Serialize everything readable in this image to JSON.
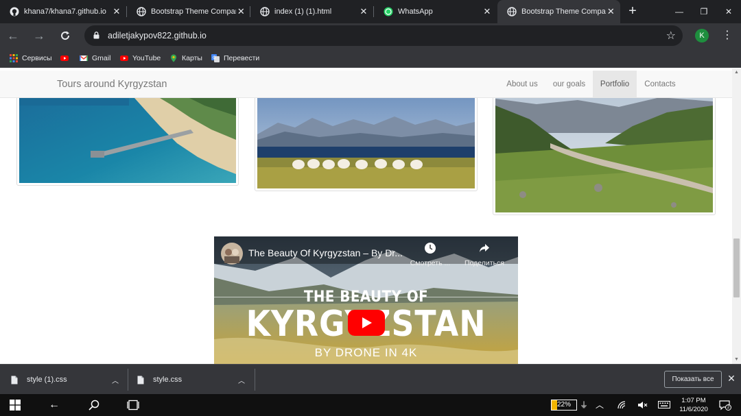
{
  "browser": {
    "tabs": [
      {
        "title": "khana7/khana7.github.io",
        "icon": "github-icon",
        "active": false
      },
      {
        "title": "Bootstrap Theme Company P",
        "icon": "globe-icon",
        "active": false
      },
      {
        "title": "index (1) (1).html",
        "icon": "globe-icon",
        "active": false
      },
      {
        "title": "WhatsApp",
        "icon": "whatsapp-icon",
        "active": false
      },
      {
        "title": "Bootstrap Theme Company P",
        "icon": "globe-icon",
        "active": true
      }
    ],
    "url": "adiletjakypov822.github.io",
    "profile_initial": "K",
    "bookmarks": [
      {
        "label": "Сервисы",
        "icon": "apps-grid-icon"
      },
      {
        "label": "",
        "icon": "youtube-icon"
      },
      {
        "label": "Gmail",
        "icon": "gmail-icon"
      },
      {
        "label": "YouTube",
        "icon": "youtube-icon"
      },
      {
        "label": "Карты",
        "icon": "maps-icon"
      },
      {
        "label": "Перевести",
        "icon": "translate-icon"
      }
    ]
  },
  "page": {
    "brand": "Tours around Kyrgyzstan",
    "nav": [
      {
        "label": "About us",
        "active": false
      },
      {
        "label": "our goals",
        "active": false
      },
      {
        "label": "Portfolio",
        "active": true
      },
      {
        "label": "Contacts",
        "active": false
      }
    ],
    "video": {
      "title": "The Beauty Of Kyrgyzstan – By Dr...",
      "watch_later": "Смотреть ...",
      "share": "Поделиться",
      "headline_top": "THE BEAUTY OF",
      "headline_main": "KYRGYZSTAN",
      "headline_sub": "BY DRONE IN 4K"
    }
  },
  "downloads": {
    "items": [
      {
        "name": "style (1).css"
      },
      {
        "name": "style.css"
      }
    ],
    "show_all": "Показать все"
  },
  "taskbar": {
    "battery": "22%",
    "battery_level": 0.22,
    "time": "1:07 PM",
    "date": "11/6/2020",
    "notifications": "2"
  },
  "colors": {
    "chrome_dark": "#202124",
    "chrome_toolbar": "#35363a",
    "navbar_bg": "#f8f8f8",
    "youtube_red": "#ff0000"
  }
}
